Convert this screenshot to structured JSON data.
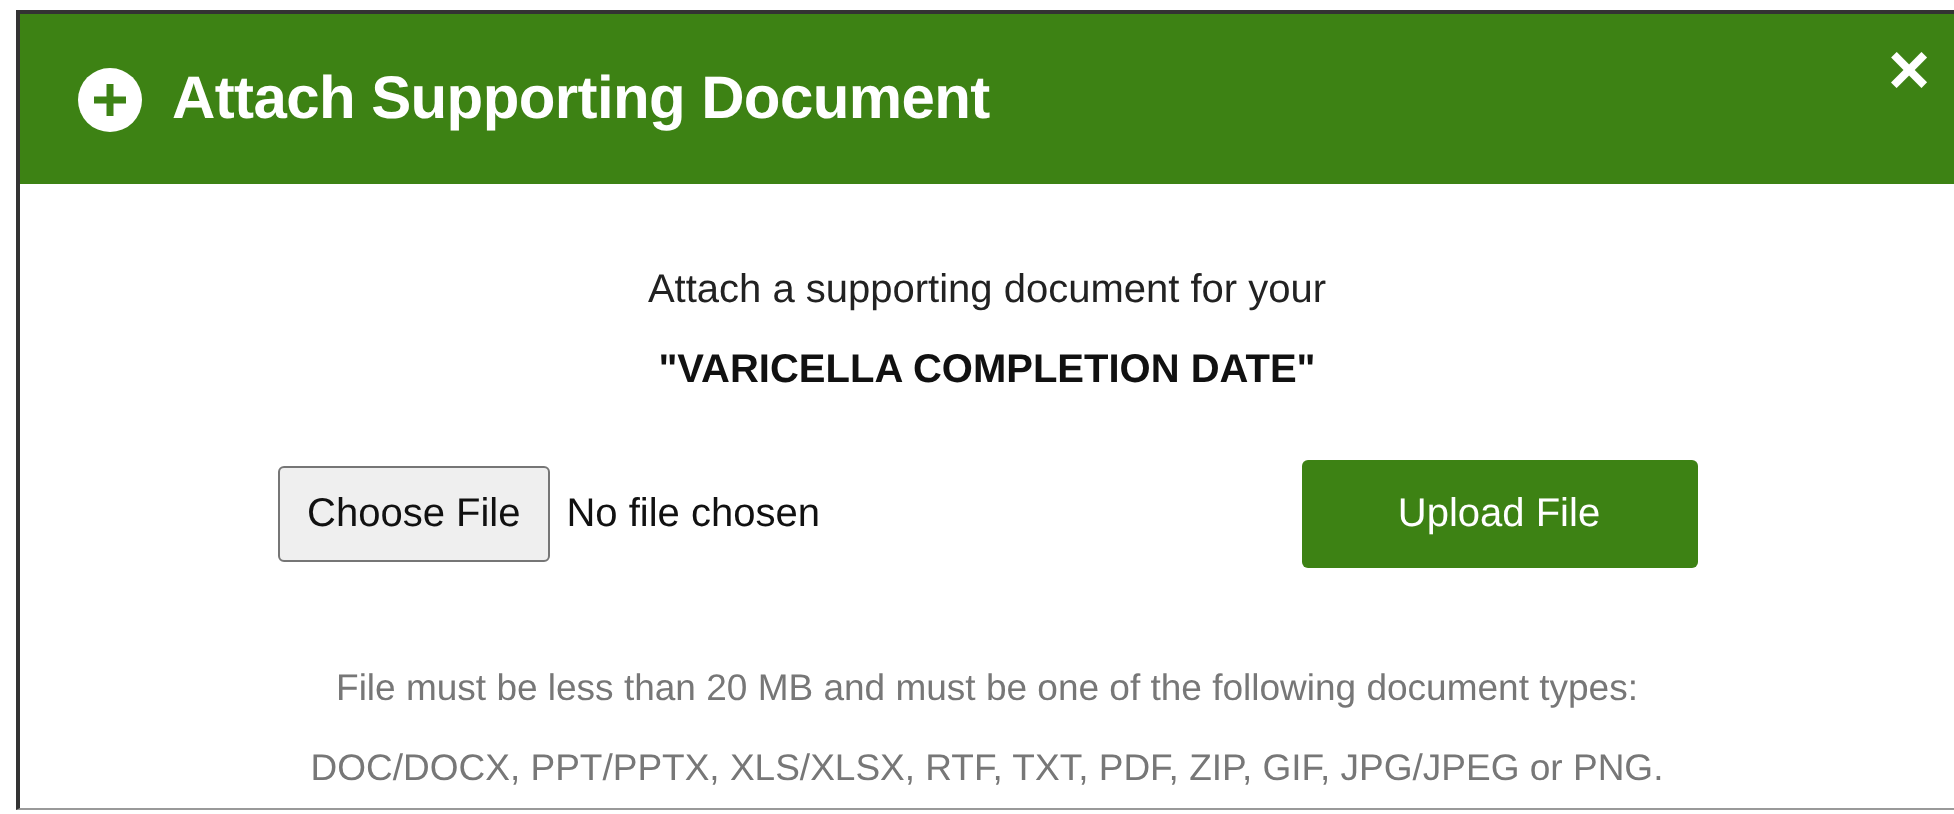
{
  "dialog": {
    "title": "Attach Supporting Document",
    "close": "×",
    "intro": "Attach a supporting document for your",
    "field_name": "\"VARICELLA COMPLETION DATE\"",
    "file_input": {
      "button": "Choose File",
      "status": "No file chosen"
    },
    "upload_button": "Upload File",
    "note_lines": [
      "File must be less than 20 MB and must be one of the following document types:",
      "DOC/DOCX, PPT/PPTX, XLS/XLSX, RTF, TXT, PDF, ZIP, GIF, JPG/JPEG or PNG."
    ]
  }
}
